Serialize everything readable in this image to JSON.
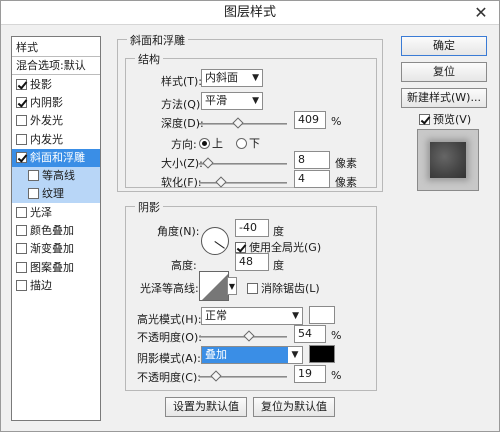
{
  "dialog": {
    "title": "图层样式",
    "close_glyph": "✕"
  },
  "sidebar": {
    "items": [
      {
        "label": "样式",
        "checkbox": false
      },
      {
        "label": "混合选项:默认",
        "checkbox": false
      },
      {
        "label": "投影",
        "checkbox": true,
        "checked": true
      },
      {
        "label": "内阴影",
        "checkbox": true,
        "checked": true
      },
      {
        "label": "外发光",
        "checkbox": true,
        "checked": false
      },
      {
        "label": "内发光",
        "checkbox": true,
        "checked": false
      },
      {
        "label": "斜面和浮雕",
        "checkbox": true,
        "checked": true,
        "selected": true
      },
      {
        "label": "等高线",
        "checkbox": true,
        "checked": false,
        "sub": true
      },
      {
        "label": "纹理",
        "checkbox": true,
        "checked": false,
        "sub": true
      },
      {
        "label": "光泽",
        "checkbox": true,
        "checked": false
      },
      {
        "label": "颜色叠加",
        "checkbox": true,
        "checked": false
      },
      {
        "label": "渐变叠加",
        "checkbox": true,
        "checked": false
      },
      {
        "label": "图案叠加",
        "checkbox": true,
        "checked": false
      },
      {
        "label": "描边",
        "checkbox": true,
        "checked": false
      }
    ]
  },
  "bevel": {
    "group_title": "斜面和浮雕",
    "structure_title": "结构",
    "style_label": "样式(T):",
    "style_value": "内斜面",
    "method_label": "方法(Q):",
    "method_value": "平滑",
    "depth_label": "深度(D):",
    "depth_value": "409",
    "depth_unit": "%",
    "direction_label": "方向:",
    "dir_up": "上",
    "dir_down": "下",
    "size_label": "大小(Z):",
    "size_value": "8",
    "size_unit": "像素",
    "soften_label": "软化(F):",
    "soften_value": "4",
    "soften_unit": "像素"
  },
  "shading": {
    "title": "阴影",
    "angle_label": "角度(N):",
    "angle_value": "-40",
    "angle_unit": "度",
    "global_light_label": "使用全局光(G)",
    "altitude_label": "高度:",
    "altitude_value": "48",
    "altitude_unit": "度",
    "gloss_label": "光泽等高线:",
    "antialias_label": "消除锯齿(L)",
    "highlight_mode_label": "高光模式(H):",
    "highlight_mode_value": "正常",
    "highlight_opacity_label": "不透明度(O):",
    "highlight_opacity_value": "54",
    "highlight_opacity_unit": "%",
    "shadow_mode_label": "阴影模式(A):",
    "shadow_mode_value": "叠加",
    "shadow_opacity_label": "不透明度(C):",
    "shadow_opacity_value": "19",
    "shadow_opacity_unit": "%",
    "highlight_color": "#ffffff",
    "shadow_color": "#000000"
  },
  "footer": {
    "make_default": "设置为默认值",
    "reset_default": "复位为默认值"
  },
  "actions": {
    "ok": "确定",
    "reset": "复位",
    "new_style": "新建样式(W)...",
    "preview_label": "预览(V)"
  }
}
